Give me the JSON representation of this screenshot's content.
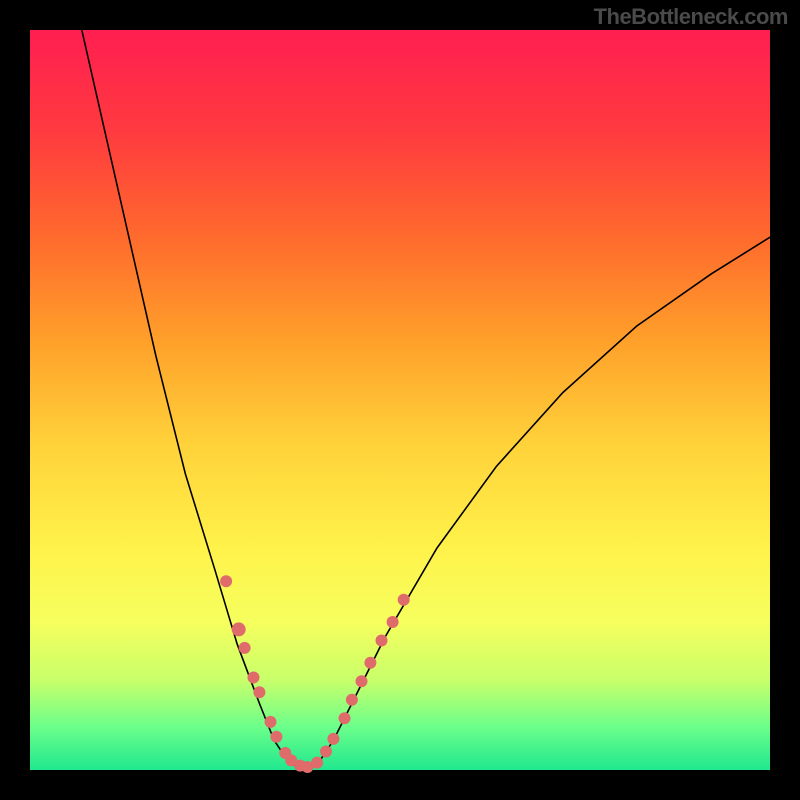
{
  "watermark": "TheBottleneck.com",
  "chart_data": {
    "type": "line",
    "title": "",
    "xlabel": "",
    "ylabel": "",
    "xlim": [
      0,
      100
    ],
    "ylim": [
      0,
      100
    ],
    "axes_visible": false,
    "gradient": {
      "stops": [
        {
          "offset": 0,
          "color": "#ff1e50"
        },
        {
          "offset": 14,
          "color": "#ff3b3f"
        },
        {
          "offset": 28,
          "color": "#ff6a2d"
        },
        {
          "offset": 42,
          "color": "#ffa02a"
        },
        {
          "offset": 56,
          "color": "#ffd23a"
        },
        {
          "offset": 70,
          "color": "#fff24a"
        },
        {
          "offset": 80,
          "color": "#f6ff5e"
        },
        {
          "offset": 88,
          "color": "#c7ff6a"
        },
        {
          "offset": 94,
          "color": "#6eff8a"
        },
        {
          "offset": 100,
          "color": "#20e88f"
        }
      ]
    },
    "series": [
      {
        "name": "bottleneck-curve",
        "stroke": "#000000",
        "stroke_width": 1.6,
        "points": [
          {
            "x": 7,
            "y": 100
          },
          {
            "x": 12,
            "y": 78
          },
          {
            "x": 17,
            "y": 56
          },
          {
            "x": 21,
            "y": 40
          },
          {
            "x": 25,
            "y": 27
          },
          {
            "x": 28,
            "y": 17
          },
          {
            "x": 31,
            "y": 9
          },
          {
            "x": 33,
            "y": 4
          },
          {
            "x": 35,
            "y": 1
          },
          {
            "x": 37,
            "y": 0
          },
          {
            "x": 39,
            "y": 1
          },
          {
            "x": 41,
            "y": 4
          },
          {
            "x": 44,
            "y": 10
          },
          {
            "x": 48,
            "y": 18
          },
          {
            "x": 55,
            "y": 30
          },
          {
            "x": 63,
            "y": 41
          },
          {
            "x": 72,
            "y": 51
          },
          {
            "x": 82,
            "y": 60
          },
          {
            "x": 92,
            "y": 67
          },
          {
            "x": 100,
            "y": 72
          }
        ]
      }
    ],
    "markers": {
      "color": "#e06b6b",
      "radius_small": 5,
      "radius_large": 7,
      "points": [
        {
          "x": 26.5,
          "y": 25.5,
          "r": 6
        },
        {
          "x": 28.2,
          "y": 19.0,
          "r": 7
        },
        {
          "x": 29.0,
          "y": 16.5,
          "r": 6
        },
        {
          "x": 30.2,
          "y": 12.5,
          "r": 6
        },
        {
          "x": 31.0,
          "y": 10.5,
          "r": 6
        },
        {
          "x": 32.5,
          "y": 6.5,
          "r": 6
        },
        {
          "x": 33.3,
          "y": 4.5,
          "r": 6
        },
        {
          "x": 34.5,
          "y": 2.3,
          "r": 6
        },
        {
          "x": 35.3,
          "y": 1.3,
          "r": 6
        },
        {
          "x": 36.5,
          "y": 0.6,
          "r": 6
        },
        {
          "x": 37.5,
          "y": 0.4,
          "r": 6
        },
        {
          "x": 38.8,
          "y": 1.0,
          "r": 6
        },
        {
          "x": 40.0,
          "y": 2.5,
          "r": 6
        },
        {
          "x": 41.0,
          "y": 4.2,
          "r": 6
        },
        {
          "x": 42.5,
          "y": 7.0,
          "r": 6
        },
        {
          "x": 43.5,
          "y": 9.5,
          "r": 6
        },
        {
          "x": 44.8,
          "y": 12.0,
          "r": 6
        },
        {
          "x": 46.0,
          "y": 14.5,
          "r": 6
        },
        {
          "x": 47.5,
          "y": 17.5,
          "r": 6
        },
        {
          "x": 49.0,
          "y": 20.0,
          "r": 6
        },
        {
          "x": 50.5,
          "y": 23.0,
          "r": 6
        }
      ]
    }
  }
}
